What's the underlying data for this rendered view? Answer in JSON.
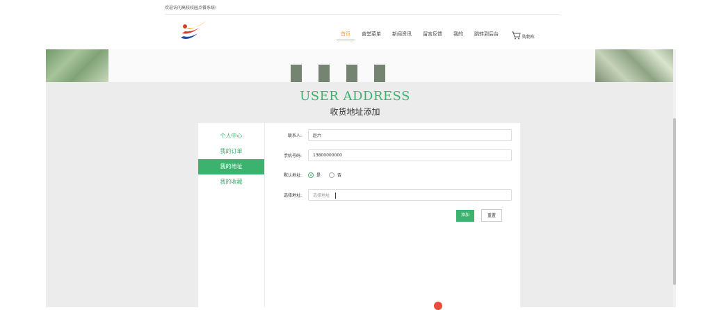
{
  "header": {
    "welcome": "欢迎访问高校校园点餐系统!",
    "logo_icon": "logo-swirl-icon"
  },
  "nav": {
    "items": [
      {
        "label": "首页",
        "active": true
      },
      {
        "label": "食堂菜单",
        "active": false
      },
      {
        "label": "新闻资讯",
        "active": false
      },
      {
        "label": "留言反馈",
        "active": false
      },
      {
        "label": "我的",
        "active": false
      },
      {
        "label": "跳转到后台",
        "active": false
      }
    ],
    "cart_label": "购物车",
    "cart_icon": "cart-icon"
  },
  "page": {
    "title_en": "USER ADDRESS",
    "title_cn": "收货地址添加"
  },
  "sidebar": {
    "items": [
      {
        "label": "个人中心",
        "active": false
      },
      {
        "label": "我的订单",
        "active": false
      },
      {
        "label": "我的地址",
        "active": true
      },
      {
        "label": "我的收藏",
        "active": false
      }
    ]
  },
  "form": {
    "contact_label": "联系人:",
    "contact_value": "赵六",
    "phone_label": "手机号码:",
    "phone_value": "13800000000",
    "default_label": "默认地址:",
    "default_options": [
      {
        "label": "是",
        "checked": true
      },
      {
        "label": "否",
        "checked": false
      }
    ],
    "address_label": "选择地址:",
    "address_placeholder": "选择地址",
    "add_button": "添加",
    "reset_button": "重置"
  },
  "colors": {
    "accent": "#3bb36f",
    "nav_active": "#e8a317"
  }
}
